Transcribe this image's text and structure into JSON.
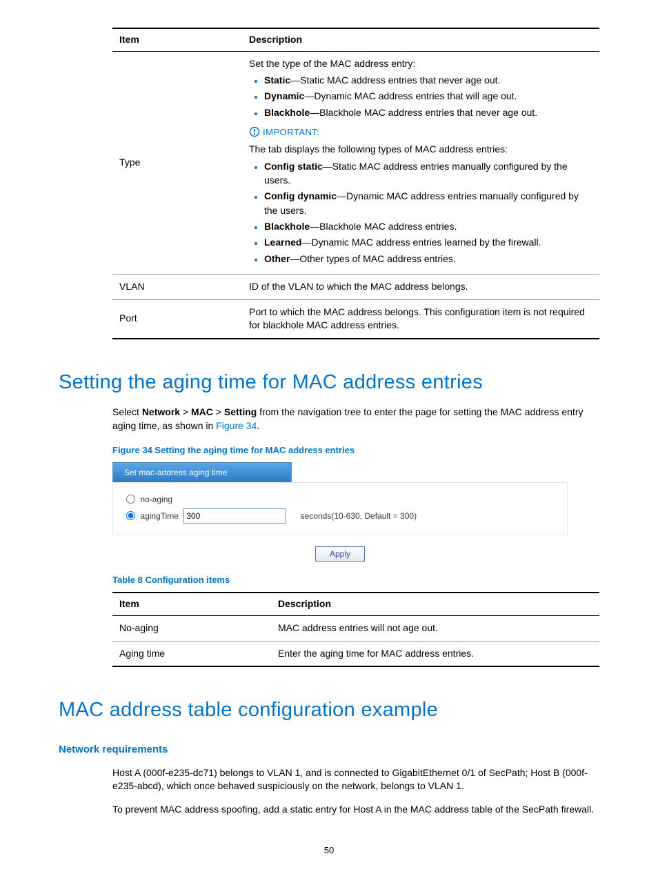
{
  "table1": {
    "headers": [
      "Item",
      "Description"
    ],
    "rowType": {
      "item": "Type",
      "intro": "Set the type of the MAC address entry:",
      "list1": [
        {
          "b": "Static",
          "t": "—Static MAC address entries that never age out."
        },
        {
          "b": "Dynamic",
          "t": "—Dynamic MAC address entries that will age out."
        },
        {
          "b": "Blackhole",
          "t": "—Blackhole MAC address entries that never age out."
        }
      ],
      "important": "IMPORTANT:",
      "intro2": "The tab displays the following types of MAC address entries:",
      "list2": [
        {
          "b": "Config static",
          "t": "—Static MAC address entries manually configured by the users."
        },
        {
          "b": "Config dynamic",
          "t": "—Dynamic MAC address entries manually configured by the users."
        },
        {
          "b": "Blackhole",
          "t": "—Blackhole MAC address entries."
        },
        {
          "b": "Learned",
          "t": "—Dynamic MAC address entries learned by the firewall."
        },
        {
          "b": "Other",
          "t": "—Other types of MAC address entries."
        }
      ]
    },
    "rowVlan": {
      "item": "VLAN",
      "desc": "ID of the VLAN to which the MAC address belongs."
    },
    "rowPort": {
      "item": "Port",
      "desc": "Port to which the MAC address belongs. This configuration item is not required for blackhole MAC address entries."
    }
  },
  "section1Title": "Setting the aging time for MAC address entries",
  "nav": {
    "pre": "Select ",
    "n1": "Network",
    "sep1": " > ",
    "n2": "MAC",
    "sep2": " > ",
    "n3": "Setting",
    "post": " from the navigation tree to enter the page for setting the MAC address entry aging time, as shown in ",
    "link": "Figure 34",
    "dot": "."
  },
  "figCaption": "Figure 34 Setting the aging time for MAC address entries",
  "fig": {
    "tab": "Set mac-address aging time",
    "noAging": "no-aging",
    "agingTime": "agingTime",
    "value": "300",
    "seconds": "seconds(10-630, Default = 300)",
    "apply": "Apply"
  },
  "tableCaption": "Table 8 Configuration items",
  "table2": {
    "headers": [
      "Item",
      "Description"
    ],
    "rows": [
      {
        "item": "No-aging",
        "desc": "MAC address entries will not age out."
      },
      {
        "item": "Aging time",
        "desc": "Enter the aging time for MAC address entries."
      }
    ]
  },
  "section2Title": "MAC address table configuration example",
  "netReqTitle": "Network requirements",
  "para1": "Host A (000f-e235-dc71) belongs to VLAN 1, and is connected to GigabitEthernet 0/1 of SecPath; Host B (000f-e235-abcd), which once behaved suspiciously on the network, belongs to VLAN 1.",
  "para2": "To prevent MAC address spoofing, add a static entry for Host A in the MAC address table of the SecPath firewall.",
  "pageNo": "50"
}
